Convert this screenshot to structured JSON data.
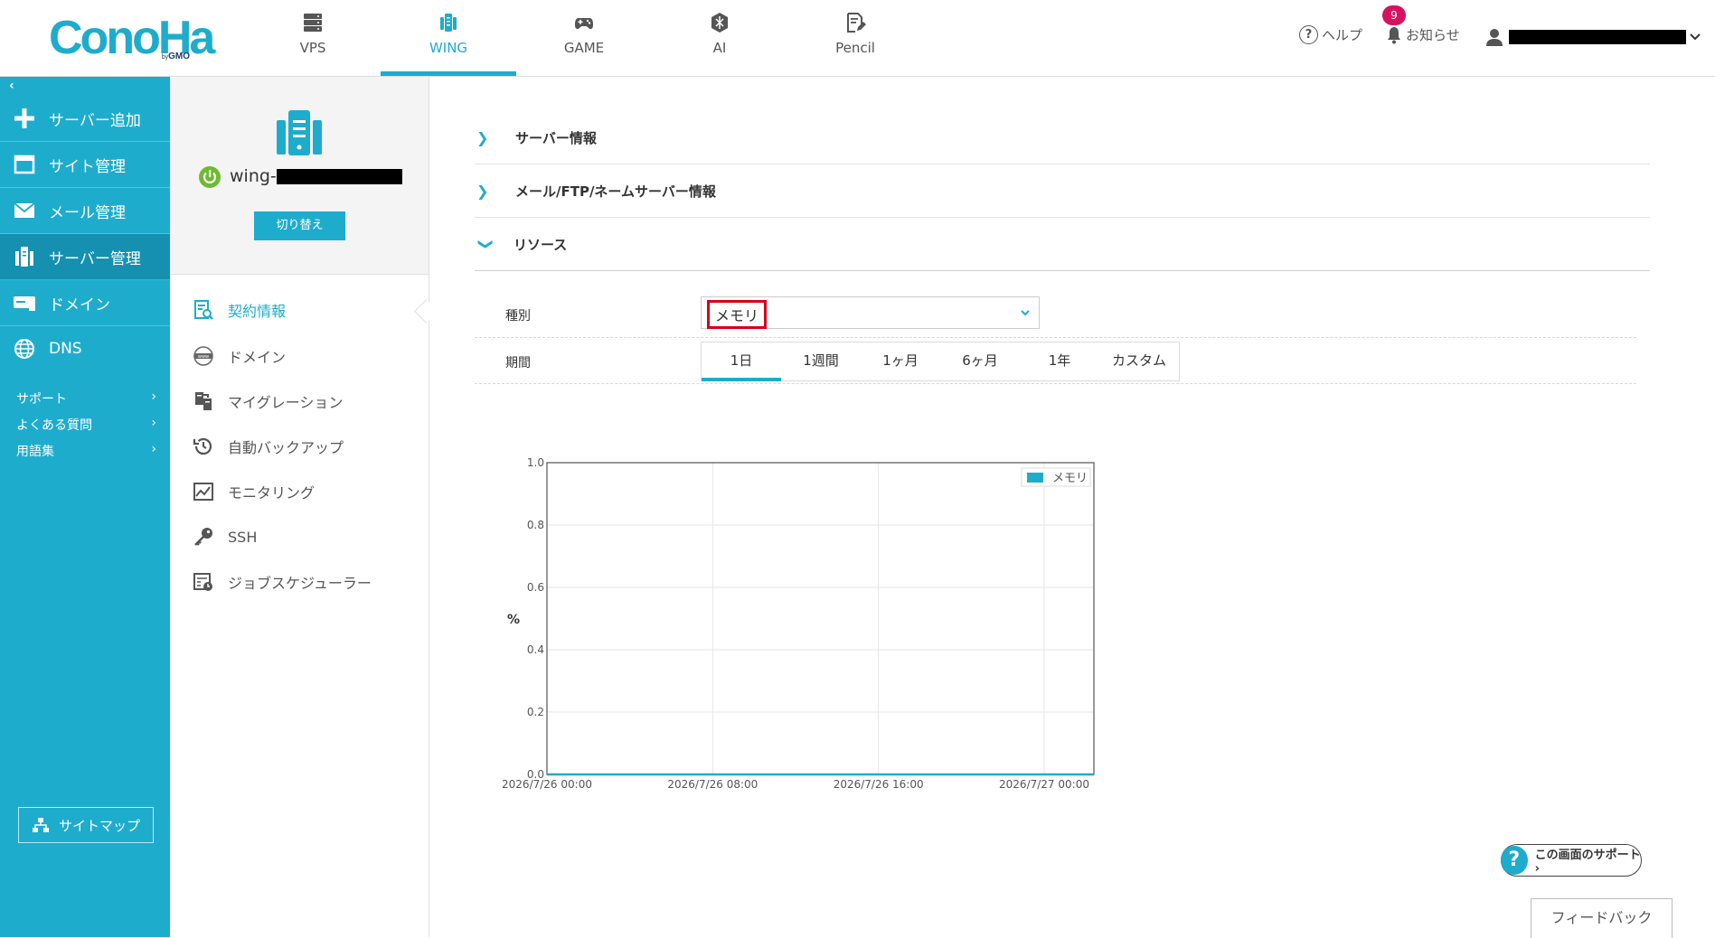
{
  "header": {
    "logo": "ConoHa",
    "logo_by": "by",
    "logo_gmo": "GMO",
    "products": [
      {
        "label": "VPS",
        "icon": "server-stack-icon"
      },
      {
        "label": "WING",
        "icon": "wing-icon",
        "active": true
      },
      {
        "label": "GAME",
        "icon": "gamepad-icon"
      },
      {
        "label": "AI",
        "icon": "ai-chip-icon"
      },
      {
        "label": "Pencil",
        "icon": "pencil-doc-icon"
      }
    ],
    "help": "ヘルプ",
    "notice": "お知らせ",
    "notice_count": "9"
  },
  "sidebar": {
    "collapse": "‹",
    "items": [
      {
        "label": "サーバー追加",
        "icon": "plus-icon"
      },
      {
        "label": "サイト管理",
        "icon": "window-icon"
      },
      {
        "label": "メール管理",
        "icon": "mail-icon"
      },
      {
        "label": "サーバー管理",
        "icon": "server-icon",
        "active": true
      },
      {
        "label": "ドメイン",
        "icon": "domain-icon"
      },
      {
        "label": "DNS",
        "icon": "globe-icon"
      }
    ],
    "links": [
      "サポート",
      "よくある質問",
      "用語集"
    ],
    "sitemap": "サイトマップ"
  },
  "server_panel": {
    "name_prefix": "wing-",
    "switch_label": "切り替え",
    "menu": [
      {
        "label": "契約情報",
        "icon": "contract-icon",
        "active": true
      },
      {
        "label": "ドメイン",
        "icon": "www-icon"
      },
      {
        "label": "マイグレーション",
        "icon": "migration-icon"
      },
      {
        "label": "自動バックアップ",
        "icon": "backup-icon"
      },
      {
        "label": "モニタリング",
        "icon": "monitoring-icon"
      },
      {
        "label": "SSH",
        "icon": "key-icon"
      },
      {
        "label": "ジョブスケジューラー",
        "icon": "scheduler-icon"
      }
    ]
  },
  "main": {
    "sections": [
      {
        "label": "サーバー情報",
        "expanded": false
      },
      {
        "label": "メール/FTP/ネームサーバー情報",
        "expanded": false
      },
      {
        "label": "リソース",
        "expanded": true
      }
    ],
    "type_label": "種別",
    "type_value": "メモリ",
    "period_label": "期間",
    "periods": [
      "1日",
      "1週間",
      "1ヶ月",
      "6ヶ月",
      "1年",
      "カスタム"
    ],
    "active_period": 0
  },
  "chart_data": {
    "type": "line",
    "ylabel": "%",
    "ylim": [
      0,
      1.0
    ],
    "yticks": [
      "0.0",
      "0.2",
      "0.4",
      "0.6",
      "0.8",
      "1.0"
    ],
    "xticks": [
      "2026/7/26 00:00",
      "2026/7/26 08:00",
      "2026/7/26 16:00",
      "2026/7/27 00:00"
    ],
    "series": [
      {
        "name": "メモリ",
        "color": "#1eaccd",
        "values": [
          0,
          0,
          0,
          0
        ]
      }
    ],
    "legend": "top-right",
    "grid": true
  },
  "footer": {
    "support_q": "?",
    "support_label": "この画面のサポート ›",
    "feedback": "フィードバック"
  },
  "colors": {
    "accent": "#1eaccd",
    "badge": "#d6135f",
    "power": "#6dbb2f",
    "highlight": "#d6001c"
  }
}
